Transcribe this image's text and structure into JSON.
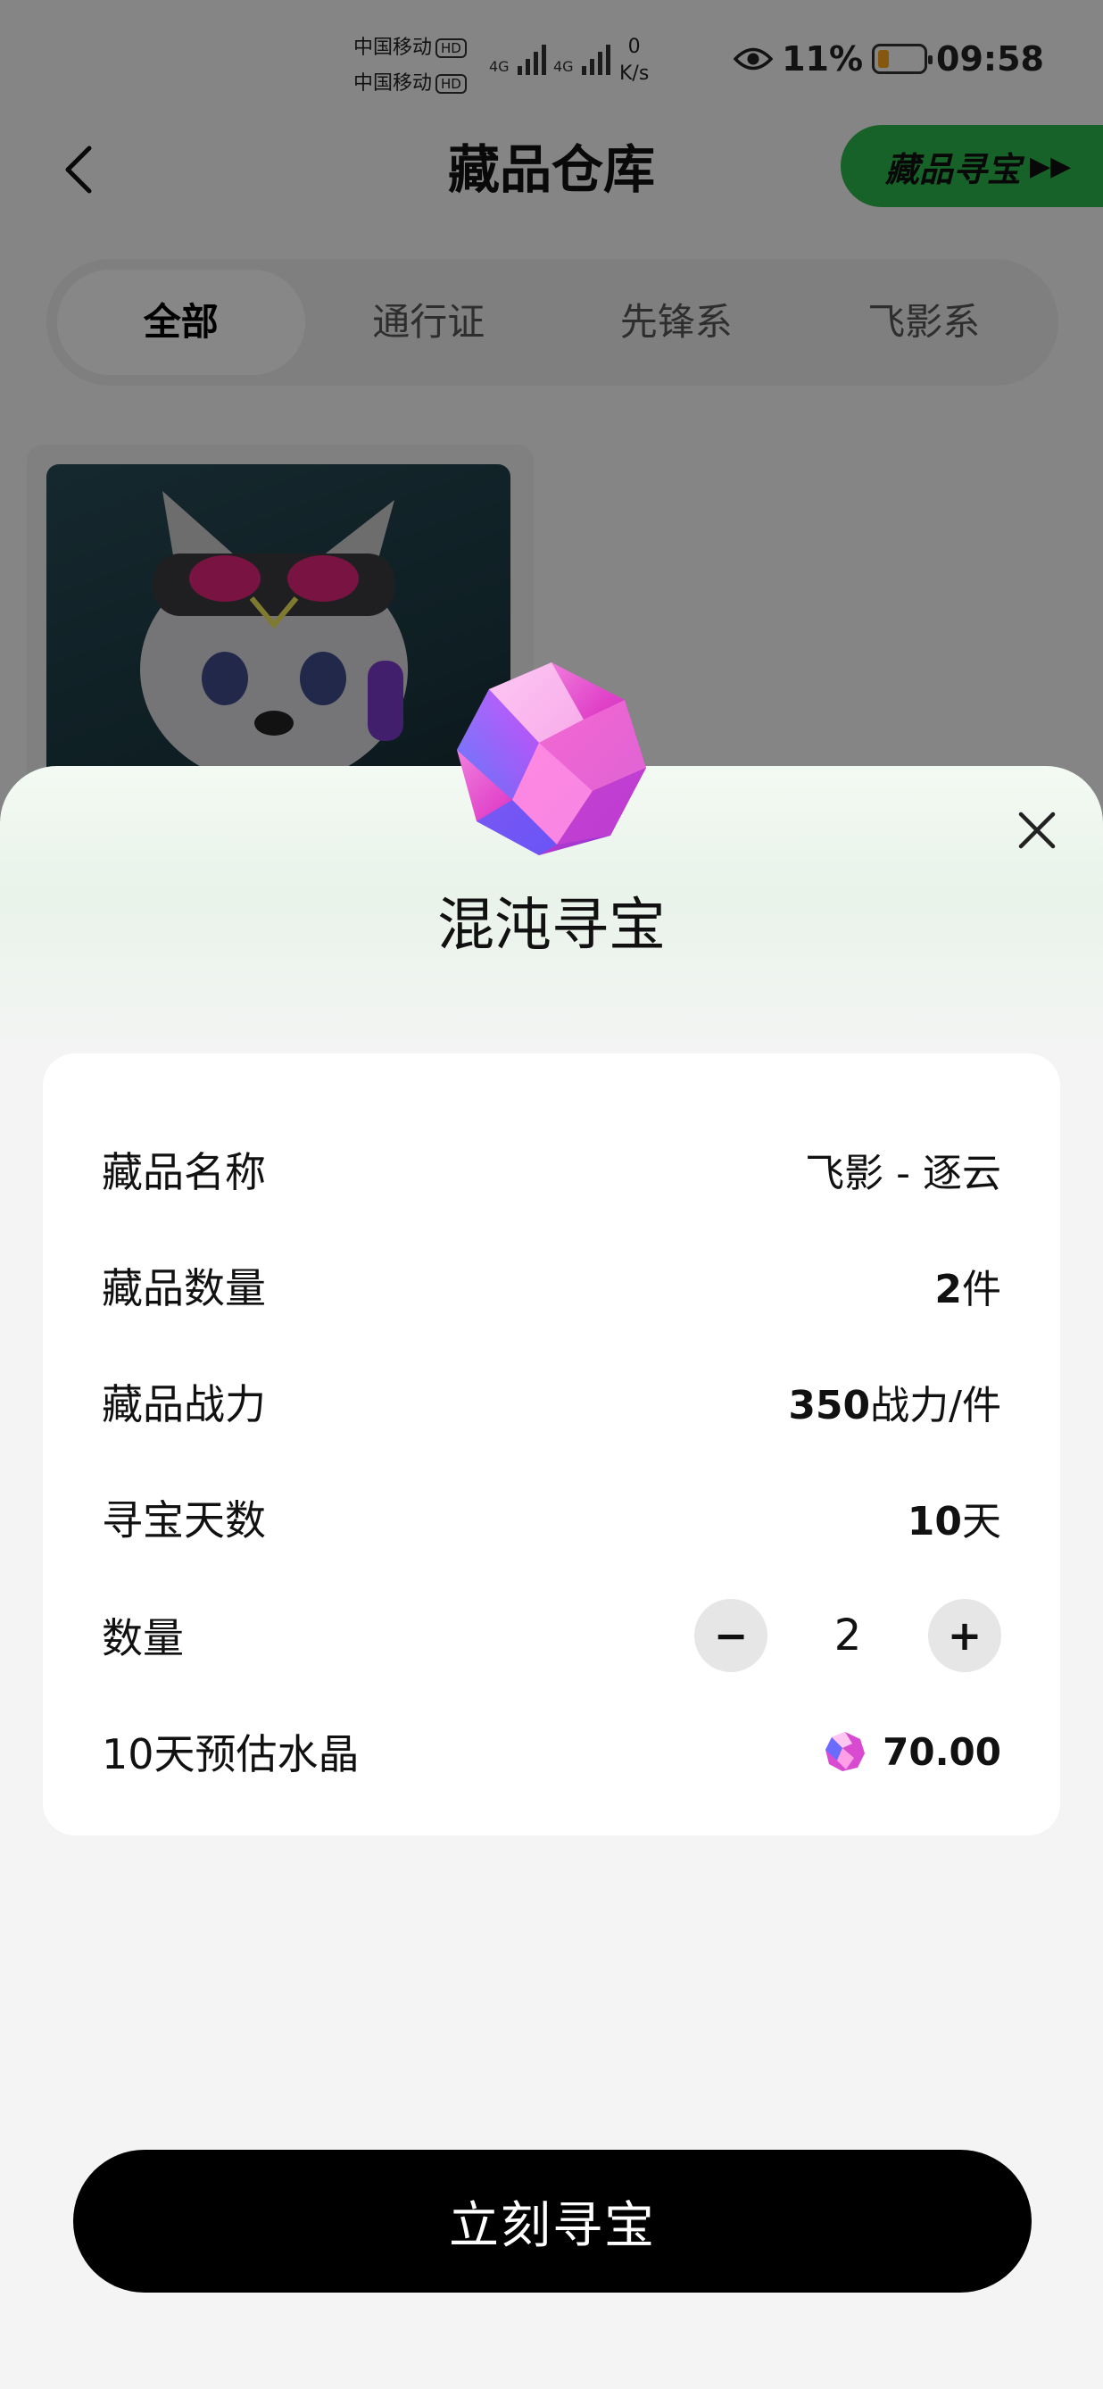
{
  "status_bar": {
    "carrier_1": "中国移动",
    "carrier_2": "中国移动",
    "hd_badge": "HD",
    "network_1": "4G",
    "network_2": "4G",
    "net_speed_value": "0",
    "net_speed_unit": "K/s",
    "battery_percent": "11%",
    "time": "09:58",
    "battery_color": "#f5a31a"
  },
  "navbar": {
    "title": "藏品仓库",
    "hunt_button_label": "藏品寻宝",
    "hunt_button_color": "#2bb54a"
  },
  "tabs": [
    {
      "label": "全部",
      "active": true
    },
    {
      "label": "通行证",
      "active": false
    },
    {
      "label": "先锋系",
      "active": false
    },
    {
      "label": "飞影系",
      "active": false
    }
  ],
  "sheet": {
    "title": "混沌寻宝",
    "rows": [
      {
        "label": "藏品名称",
        "value": "飞影 - 逐云"
      },
      {
        "label": "藏品数量",
        "value_num": "2",
        "value_unit": "件"
      },
      {
        "label": "藏品战力",
        "value_num": "350",
        "value_unit": "战力/件"
      },
      {
        "label": "寻宝天数",
        "value_num": "10",
        "value_unit": "天"
      },
      {
        "label": "数量",
        "minus_label": "−",
        "quantity": "2",
        "plus_label": "+"
      },
      {
        "label": "10天预估水晶",
        "value_num": "70.00"
      }
    ],
    "cta_label": "立刻寻宝"
  }
}
